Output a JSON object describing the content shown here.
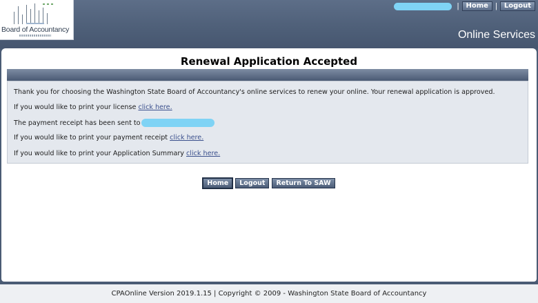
{
  "header": {
    "logo_text": "Board of Accountancy",
    "top_links": [
      {
        "id": "home",
        "label": "Home"
      },
      {
        "id": "logout",
        "label": "Logout"
      }
    ],
    "separator": "|",
    "section_title": "Online Services"
  },
  "main": {
    "title": "Renewal Application Accepted",
    "lines": {
      "thanks": "Thank you for choosing the Washington State Board of Accountancy's online services to renew your online. Your renewal application is approved.",
      "license_prefix": "If you would like to print your license ",
      "license_link": "click here.",
      "receipt_sent_prefix": "The payment receipt has been sent to",
      "receipt_prefix": "If you would like to print your payment receipt ",
      "receipt_link": "click here.",
      "summary_prefix": "If you would like to print your Application Summary ",
      "summary_link": "click here."
    },
    "buttons": {
      "home": "Home",
      "logout": "Logout",
      "return": "Return To SAW"
    }
  },
  "footer": {
    "text": "CPAOnline Version 2019.1.15 | Copyright © 2009 - Washington State Board of Accountancy"
  },
  "colors": {
    "header_bg": "#4f6079",
    "redaction": "#7fd3f5",
    "link": "#3a4f8c"
  }
}
